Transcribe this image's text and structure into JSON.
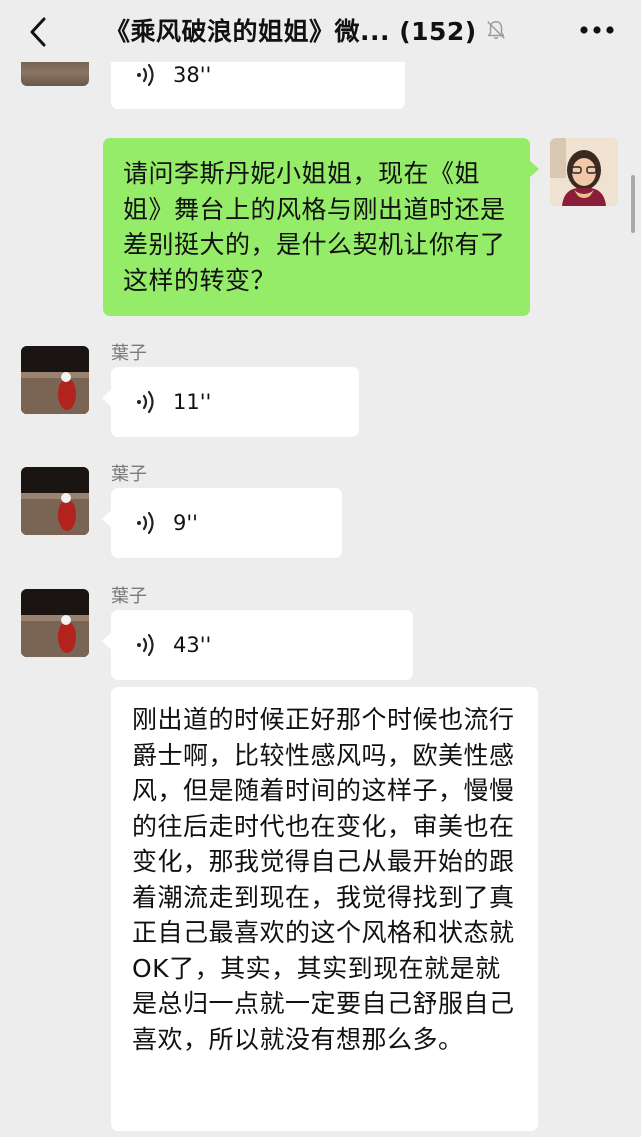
{
  "header": {
    "title": "《乘风破浪的姐姐》微... (152)",
    "back_icon": "chevron-left-icon",
    "mute_icon": "bell-muted-icon",
    "more_icon": "more-dots-icon"
  },
  "messages": [
    {
      "type": "voice",
      "side": "left",
      "duration": "38''"
    },
    {
      "type": "text",
      "side": "right",
      "text": "请问李斯丹妮小姐姐，现在《姐姐》舞台上的风格与刚出道时还是差别挺大的，是什么契机让你有了这样的转变？"
    },
    {
      "type": "voice",
      "side": "left",
      "sender": "葉子",
      "duration": "11''"
    },
    {
      "type": "voice",
      "side": "left",
      "sender": "葉子",
      "duration": "9''"
    },
    {
      "type": "voice",
      "side": "left",
      "sender": "葉子",
      "duration": "43''"
    },
    {
      "type": "text",
      "side": "left",
      "text": "刚出道的时候正好那个时候也流行爵士啊，比较性感风吗，欧美性感风，但是随着时间的这样子，慢慢的往后走时代也在变化，审美也在变化，那我觉得自己从最开始的跟着潮流走到现在，我觉得找到了真正自己最喜欢的这个风格和状态就OK了，其实，其实到现在就是就是总归一点就一定要自己舒服自己喜欢，所以就没有想那么多。"
    }
  ],
  "colors": {
    "background": "#ededed",
    "self_bubble": "#95ec69",
    "other_bubble": "#ffffff"
  }
}
